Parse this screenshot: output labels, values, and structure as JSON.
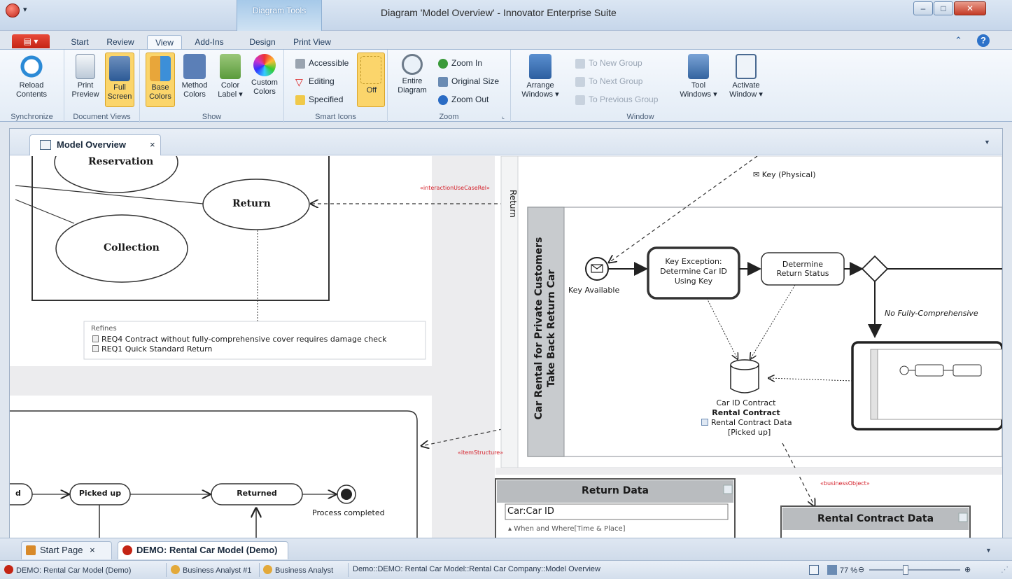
{
  "window": {
    "title": "Diagram 'Model Overview' - Innovator Enterprise Suite",
    "context_tab_group": "Diagram Tools"
  },
  "ribbon_tabs": [
    "Start",
    "Review",
    "View",
    "Add-Ins",
    "Design",
    "Print View"
  ],
  "ribbon_active_tab": "View",
  "ribbon": {
    "synchronize": {
      "label": "Synchronize",
      "reload": "Reload Contents"
    },
    "document_views": {
      "label": "Document Views",
      "print_preview": "Print Preview",
      "full_screen": "Full Screen"
    },
    "show": {
      "label": "Show",
      "base_colors": "Base Colors",
      "method_colors": "Method Colors",
      "color_label": "Color Label ▾",
      "custom_colors": "Custom Colors"
    },
    "smart_icons": {
      "label": "Smart Icons",
      "accessible": "Accessible",
      "editing": "Editing",
      "specified": "Specified",
      "off": "Off"
    },
    "zoom": {
      "label": "Zoom",
      "entire_diagram": "Entire Diagram",
      "zoom_in": "Zoom In",
      "original_size": "Original Size",
      "zoom_out": "Zoom Out"
    },
    "window": {
      "label": "Window",
      "arrange_windows": "Arrange Windows ▾",
      "to_new_group": "To New Group",
      "to_next_group": "To Next Group",
      "to_previous_group": "To Previous Group",
      "tool_windows": "Tool Windows ▾",
      "activate_window": "Activate Window ▾"
    }
  },
  "document_tab": {
    "label": "Model Overview",
    "close": "×"
  },
  "diagram": {
    "usecases": {
      "reservation": "Reservation",
      "return": "Return",
      "collection": "Collection"
    },
    "rel_interaction": "«interactionUseCaseRel»",
    "rel_item_structure": "«itemStructure»",
    "rel_business_object": "«businessObject»",
    "refines": {
      "title": "Refines",
      "items": [
        "REQ4 Contract without fully-comprehensive cover requires damage check",
        "REQ1 Quick Standard Return"
      ]
    },
    "lane_return": "Return",
    "pool_title_line1": "Car Rental for Private Customers",
    "pool_title_line2": "Take Back Return Car",
    "key_physical": "Key (Physical)",
    "key_available": "Key Available",
    "task_key_exception": [
      "Key Exception:",
      "Determine Car ID",
      "Using Key"
    ],
    "task_determine_return": [
      "Determine",
      "Return Status"
    ],
    "no_fully_comprehensive": "No Fully-Comprehensive",
    "datastore": {
      "line1": "Car ID Contract",
      "line2": "Rental Contract",
      "line3": "Rental Contract Data",
      "line4": "[Picked up]"
    },
    "states": {
      "partial_d": "d",
      "picked_up": "Picked up",
      "returned": "Returned",
      "process_completed": "Process completed"
    },
    "return_data": {
      "title": "Return Data",
      "field": "Car:Car ID",
      "section": "▴ When and Where[Time & Place]"
    },
    "rental_contract_data": {
      "title": "Rental Contract Data"
    }
  },
  "bottom_tabs": [
    {
      "label": "Start Page",
      "close": "×"
    },
    {
      "label": "DEMO: Rental Car Model (Demo)",
      "close": "×"
    }
  ],
  "status": {
    "model": "DEMO: Rental Car Model (Demo)",
    "user": "Business Analyst #1",
    "role": "Business Analyst",
    "path": "Demo::DEMO: Rental Car Model::Rental Car Company::Model Overview",
    "zoom": "77 %"
  },
  "colors": {
    "accent_red": "#c42414",
    "selected_yellow": "#fbd56b",
    "ribbon_blue": "#dbe6f3",
    "relation_red": "#d5202a"
  }
}
